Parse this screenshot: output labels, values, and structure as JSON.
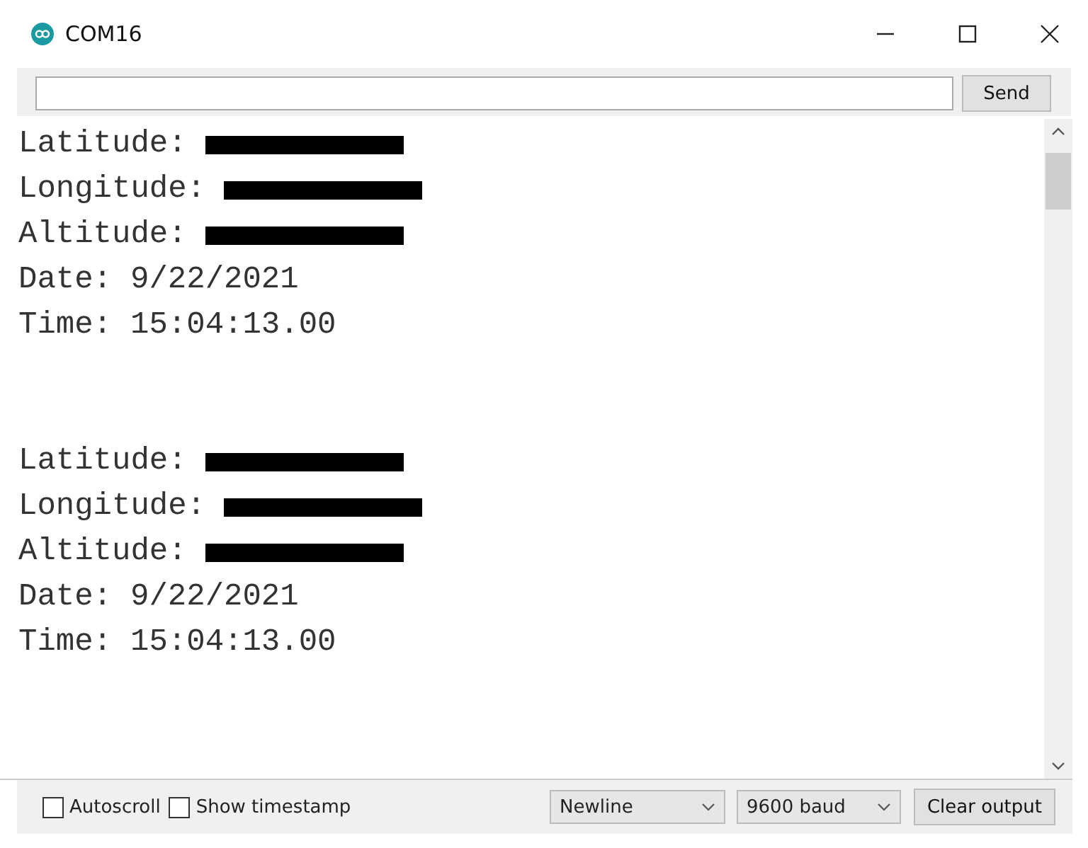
{
  "window": {
    "title": "COM16"
  },
  "send_bar": {
    "button": "Send"
  },
  "output": {
    "blocks": [
      {
        "lines": [
          {
            "kind": "redacted",
            "label": "Latitude:"
          },
          {
            "kind": "redacted",
            "label": "Longitude:"
          },
          {
            "kind": "redacted",
            "label": "Altitude:"
          },
          {
            "kind": "text",
            "label": "Date:",
            "value": "9/22/2021"
          },
          {
            "kind": "text",
            "label": "Time:",
            "value": "15:04:13.00"
          }
        ]
      },
      {
        "lines": [
          {
            "kind": "redacted",
            "label": "Latitude:"
          },
          {
            "kind": "redacted",
            "label": "Longitude:"
          },
          {
            "kind": "redacted",
            "label": "Altitude:"
          },
          {
            "kind": "text",
            "label": "Date:",
            "value": "9/22/2021"
          },
          {
            "kind": "text",
            "label": "Time:",
            "value": "15:04:13.00"
          }
        ]
      }
    ]
  },
  "footer": {
    "checkboxes": [
      {
        "label": "Autoscroll",
        "checked": false
      },
      {
        "label": "Show timestamp",
        "checked": false
      }
    ],
    "line_ending": "Newline",
    "baud": "9600 baud",
    "clear_button": "Clear output"
  }
}
